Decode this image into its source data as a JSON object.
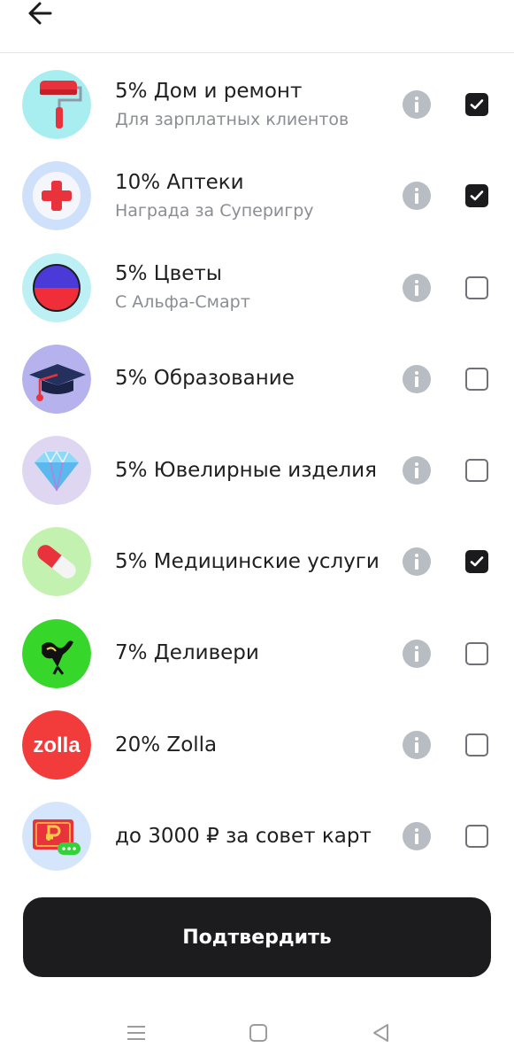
{
  "header": {
    "back_icon": "arrow-left-icon"
  },
  "items": [
    {
      "title": "5% Дом и ремонт",
      "subtitle": "Для зарплатных клиентов",
      "checked": true,
      "icon": "paint-roller-icon",
      "bg": "#a8eef0"
    },
    {
      "title": "10% Аптеки",
      "subtitle": "Награда за Суперигру",
      "checked": true,
      "icon": "medical-cross-icon",
      "bg": "#cfe0fb"
    },
    {
      "title": "5% Цветы",
      "subtitle": "С Альфа-Смарт",
      "checked": false,
      "icon": "flower-ball-icon",
      "bg": "#bdf0f4"
    },
    {
      "title": "5% Образование",
      "subtitle": "",
      "checked": false,
      "icon": "graduation-cap-icon",
      "bg": "#b5b2ee"
    },
    {
      "title": "5% Ювелирные изделия",
      "subtitle": "",
      "checked": false,
      "icon": "diamond-icon",
      "bg": "#dfd6f1"
    },
    {
      "title": "5% Медицинские услуги",
      "subtitle": "",
      "checked": true,
      "icon": "pill-icon",
      "bg": "#c3f2b0"
    },
    {
      "title": "7% Деливери",
      "subtitle": "",
      "checked": false,
      "icon": "ostrich-icon",
      "bg": "#36d62a"
    },
    {
      "title": "20% Zolla",
      "subtitle": "",
      "checked": false,
      "icon": "zolla-logo-icon",
      "bg": "#f23c3c",
      "logo_text": "zolla"
    },
    {
      "title": "до 3000 ₽ за совет карт",
      "subtitle": "",
      "checked": false,
      "icon": "ruble-card-icon",
      "bg": "#d5e6fc"
    }
  ],
  "confirm_label": "Подтвердить",
  "navbar": {
    "menu_icon": "menu-icon",
    "home_icon": "home-square-icon",
    "back_icon": "triangle-back-icon"
  }
}
